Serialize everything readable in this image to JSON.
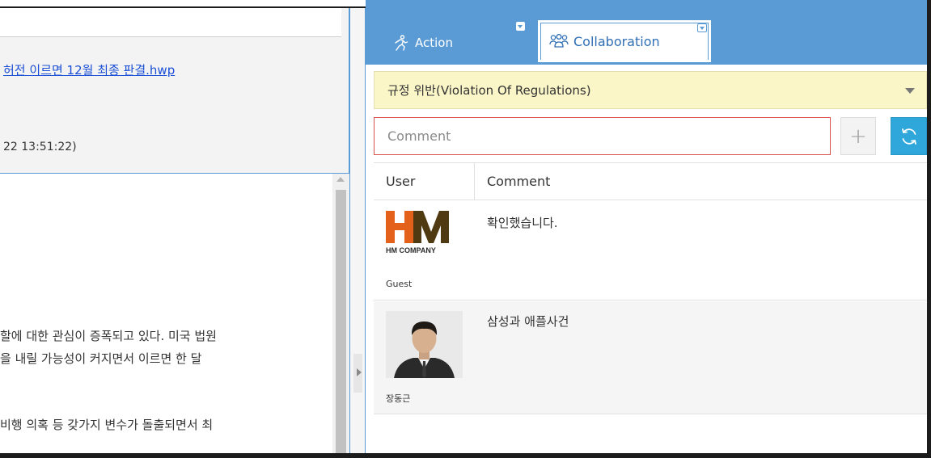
{
  "left_panel": {
    "file_link": "허전 이르면 12월 최종 판결.hwp",
    "timestamp": "22 13:51:22)",
    "article_lines": [
      "할에 대한 관심이 증폭되고 있다. 미국 법원",
      "을 내릴 가능성이 커지면서 이르면 한 달",
      "비행 의혹 등 갖가지 변수가 돌출되면서 최"
    ]
  },
  "tabs": {
    "action_label": "Action",
    "action_icon": "running-person-icon",
    "collaboration_label": "Collaboration",
    "collaboration_icon": "users-group-icon"
  },
  "category_select": {
    "selected": "규정 위반(Violation Of Regulations)"
  },
  "comment_form": {
    "placeholder": "Comment",
    "add_label": "+",
    "refresh_icon": "refresh-icon"
  },
  "comments_table": {
    "columns": [
      "User",
      "Comment"
    ],
    "rows": [
      {
        "user_name": "Guest",
        "avatar_logo": "HM",
        "avatar_logo_sub": "HM COMPANY",
        "comment": "확인했습니다."
      },
      {
        "user_name": "장동근",
        "comment": "삼성과 애플사건"
      }
    ]
  },
  "colors": {
    "accent_blue": "#5b9bd5",
    "select_bg": "#fbf6c8",
    "error_border": "#d9534f",
    "refresh_button": "#2fa7da",
    "link": "#1a4fd6",
    "logo_orange": "#e4611b",
    "logo_brown": "#4f3a12"
  }
}
